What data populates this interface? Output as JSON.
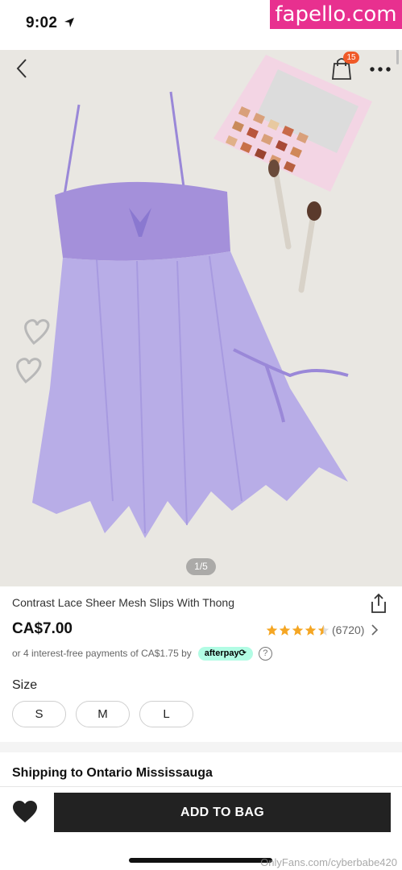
{
  "status_bar": {
    "time": "9:02"
  },
  "watermark_top": "fapello.com",
  "header": {
    "bag_count": "15"
  },
  "gallery": {
    "pager": "1/5"
  },
  "product": {
    "title": "Contrast Lace Sheer Mesh Slips With Thong",
    "price": "CA$7.00",
    "rating": {
      "stars": 4.5,
      "max": 5,
      "count": "(6720)",
      "star_color": "#f5a623"
    },
    "installments": {
      "text": "or 4 interest-free payments of CA$1.75 by",
      "provider": "afterpay⟳"
    }
  },
  "sizes": {
    "label": "Size",
    "options": [
      "S",
      "M",
      "L"
    ]
  },
  "shipping": "Shipping to Ontario Mississauga",
  "bottom_bar": {
    "add_to_bag": "ADD TO BAG"
  },
  "watermark_bottom": "OnlyFans.com/cyberbabe420",
  "colors": {
    "accent": "#222222",
    "badge": "#f05a28",
    "afterpay": "#b2fce4",
    "garment": "#a998e0"
  }
}
